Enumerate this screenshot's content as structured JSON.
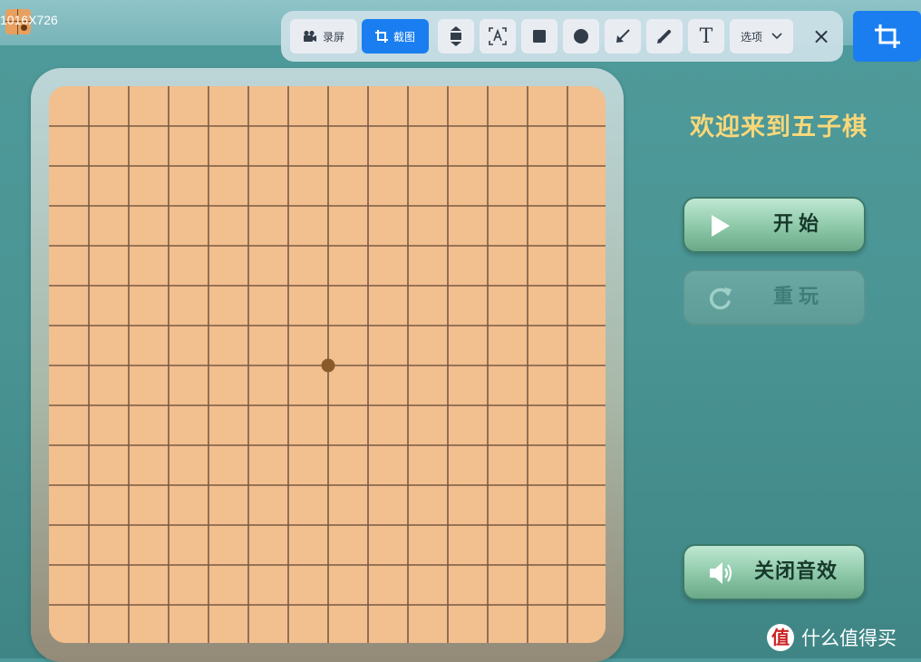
{
  "window": {
    "size_label": "1016X726",
    "close_glyph": "×"
  },
  "toolbar": {
    "record_label": "录屏",
    "screenshot_label": "截图",
    "options_label": "选项",
    "text_tool_glyph": "T",
    "close_glyph": "×",
    "accent_color": "#1a7ef0"
  },
  "game": {
    "title": "欢迎来到五子棋",
    "board": {
      "lines": 15,
      "color": "#f2bf8f",
      "line_color": "#7b5a45",
      "star_point": [
        7,
        7
      ],
      "star_color": "#8b5a2b"
    },
    "buttons": {
      "start": "开始",
      "replay": "重玩",
      "sound_off": "关闭音效"
    }
  },
  "watermark": {
    "logo_glyph": "值",
    "text": "什么值得买"
  }
}
